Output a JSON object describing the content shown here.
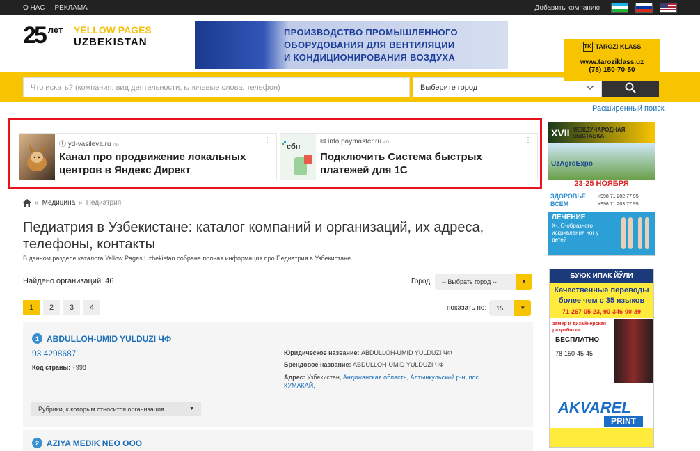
{
  "topbar": {
    "about": "О НАС",
    "ads": "РЕКЛАМА",
    "add_company": "Добавить компанию"
  },
  "logo": {
    "years": "25",
    "years_word": "лет",
    "brand_line1": "YELLOW PAGES",
    "brand_line2": "UZBEKISTAN"
  },
  "banner": {
    "line1": "ПРОИЗВОДСТВО ПРОМЫШЛЕННОГО",
    "line2": "ОБОРУДОВАНИЯ ДЛЯ ВЕНТИЛЯЦИИ",
    "line3": "И КОНДИЦИОНИРОВАНИЯ ВОЗДУХА"
  },
  "tarozi": {
    "brand": "TAROZI KLASS",
    "url": "www.taroziklass.uz",
    "phone": "(78) 150-70-50"
  },
  "search": {
    "placeholder": "Что искать? (компания, вид деятельности, ключевые слова, телефон)",
    "city_select": "Выберите город",
    "advanced": "Расширенный поиск"
  },
  "ads": [
    {
      "source": "yd-vasileva.ru",
      "tag": "AD",
      "title": "Канал про продвижение локальных центров в Яндекс Директ"
    },
    {
      "source": "info.paymaster.ru",
      "tag": "AD",
      "title": "Подключить Система быстрых платежей для 1С"
    }
  ],
  "breadcrumb": {
    "section": "Медицина",
    "current": "Педиатрия",
    "sep": "»"
  },
  "page": {
    "title": "Педиатрия в Узбекистане: каталог компаний и организаций, их адреса, телефоны, контакты",
    "lead": "В данном разделе каталога Yellow Pages Uzbekistan собрана полная информация про Педиатрия в Узбекистане",
    "found_label": "Найдено организаций: 46",
    "city_label": "Город:",
    "city_value": "-- Выбрать город --",
    "perpage_label": "показать по:",
    "perpage_value": "15",
    "pages": [
      "1",
      "2",
      "3",
      "4"
    ]
  },
  "companies": [
    {
      "num": "1",
      "name": "ABDULLOH-UMID YULDUZI ЧФ",
      "phone": "93 4298687",
      "code_label": "Код страны:",
      "code": "+998",
      "legal_label": "Юридическое название:",
      "legal": "ABDULLOH-UMID YULDUZI ЧФ",
      "brand_label": "Брендовое название:",
      "brand": "ABDULLOH-UMID YULDUZI ЧФ",
      "addr_label": "Адрес:",
      "addr_country": "Узбекистан,",
      "addr_region": "Андижанская область,",
      "addr_district": "Алтынкульский р-н, пос.",
      "addr_place": "КУМАКАЙ,",
      "rubrics": "Рубрики, к которым относится организация"
    },
    {
      "num": "2",
      "name": "AZIYA MEDIK NEO OOO"
    }
  ],
  "side": {
    "expo_num": "XVII",
    "expo_title": "МЕЖДУНАРОДНАЯ ВЫСТАВКА",
    "expo_name": "UzAgroExpo",
    "expo_dates": "23-25 НОЯБРЯ",
    "health": "ЗДОРОВЬЕ ВСЕМ",
    "health_phone1": "+998 71 202 77 95",
    "health_phone2": "+998 71 203 77 95",
    "treat_title": "ЛЕЧЕНИЕ",
    "treat_text": "Х-, О-образного искривления ног у детей",
    "print_top": "БУЮК ИПАК ЙЎЛИ",
    "print_offer": "Качественные переводы более чем с 35 языков",
    "print_phones": "71-267-05-23, 90-346-00-39",
    "print_design": "замер и дизайнерская разработка",
    "print_free": "БЕСПЛАТНО",
    "print_phone2": "78-150-45-45",
    "print_brand": "AKVAREL",
    "print_brand2": "PRINT"
  }
}
